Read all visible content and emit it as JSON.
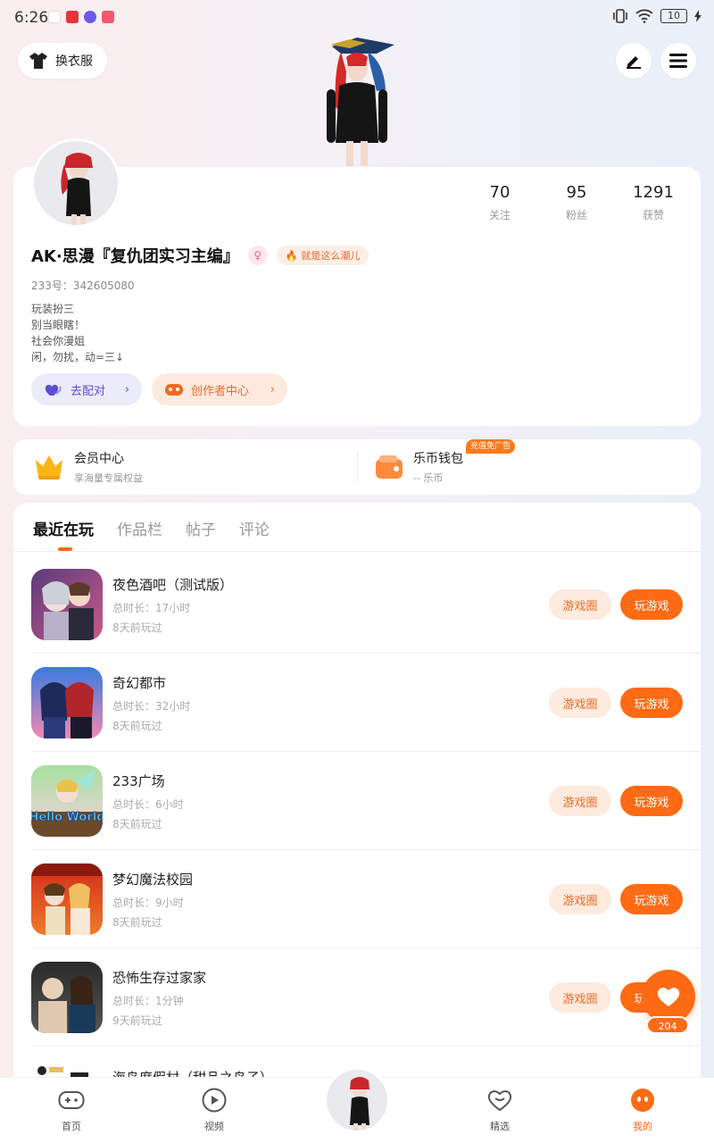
{
  "status_bar": {
    "time": "6:26",
    "battery": "10"
  },
  "header": {
    "outfit_label": "换衣服"
  },
  "profile": {
    "stats": [
      {
        "value": "70",
        "label": "关注"
      },
      {
        "value": "95",
        "label": "粉丝"
      },
      {
        "value": "1291",
        "label": "获赞"
      }
    ],
    "name": "AK·思漫『复仇团实习主编』",
    "tag": "就是这么潮儿",
    "uid": "233号：342605080",
    "bio": [
      "玩装扮三",
      "别当眼瞎！",
      "社会你漫姐",
      "闲，勿扰，动=三↓"
    ],
    "match_label": "去配对",
    "creator_label": "创作者中心"
  },
  "member": {
    "title": "会员中心",
    "sub": "享海量专属权益",
    "wallet_title": "乐币钱包",
    "wallet_sub": "-- 乐币",
    "ad_badge": "充值免广告"
  },
  "tabs": [
    {
      "label": "最近在玩",
      "active": true
    },
    {
      "label": "作品栏"
    },
    {
      "label": "帖子"
    },
    {
      "label": "评论"
    }
  ],
  "games": [
    {
      "name": "夜色酒吧（测试版）",
      "time": "总时长：17小时",
      "last": "8天前玩过"
    },
    {
      "name": "奇幻都市",
      "time": "总时长：32小时",
      "last": "8天前玩过"
    },
    {
      "name": "233广场",
      "time": "总时长：6小时",
      "last": "8天前玩过"
    },
    {
      "name": "梦幻魔法校园",
      "time": "总时长：9小时",
      "last": "8天前玩过"
    },
    {
      "name": "恐怖生存过家家",
      "time": "总时长：1分钟",
      "last": "9天前玩过"
    }
  ],
  "game_buttons": {
    "circle": "游戏圈",
    "play": "玩游戏"
  },
  "partial_game": "海岛度假村（甜品之岛子）",
  "hello_world": "Hello World",
  "like_count": "204",
  "nav": [
    {
      "label": "首页"
    },
    {
      "label": "视频"
    },
    {
      "label": "精选"
    },
    {
      "label": "我的"
    }
  ],
  "colors": {
    "accent": "#ff6a14",
    "purple": "#5a4fcf"
  }
}
